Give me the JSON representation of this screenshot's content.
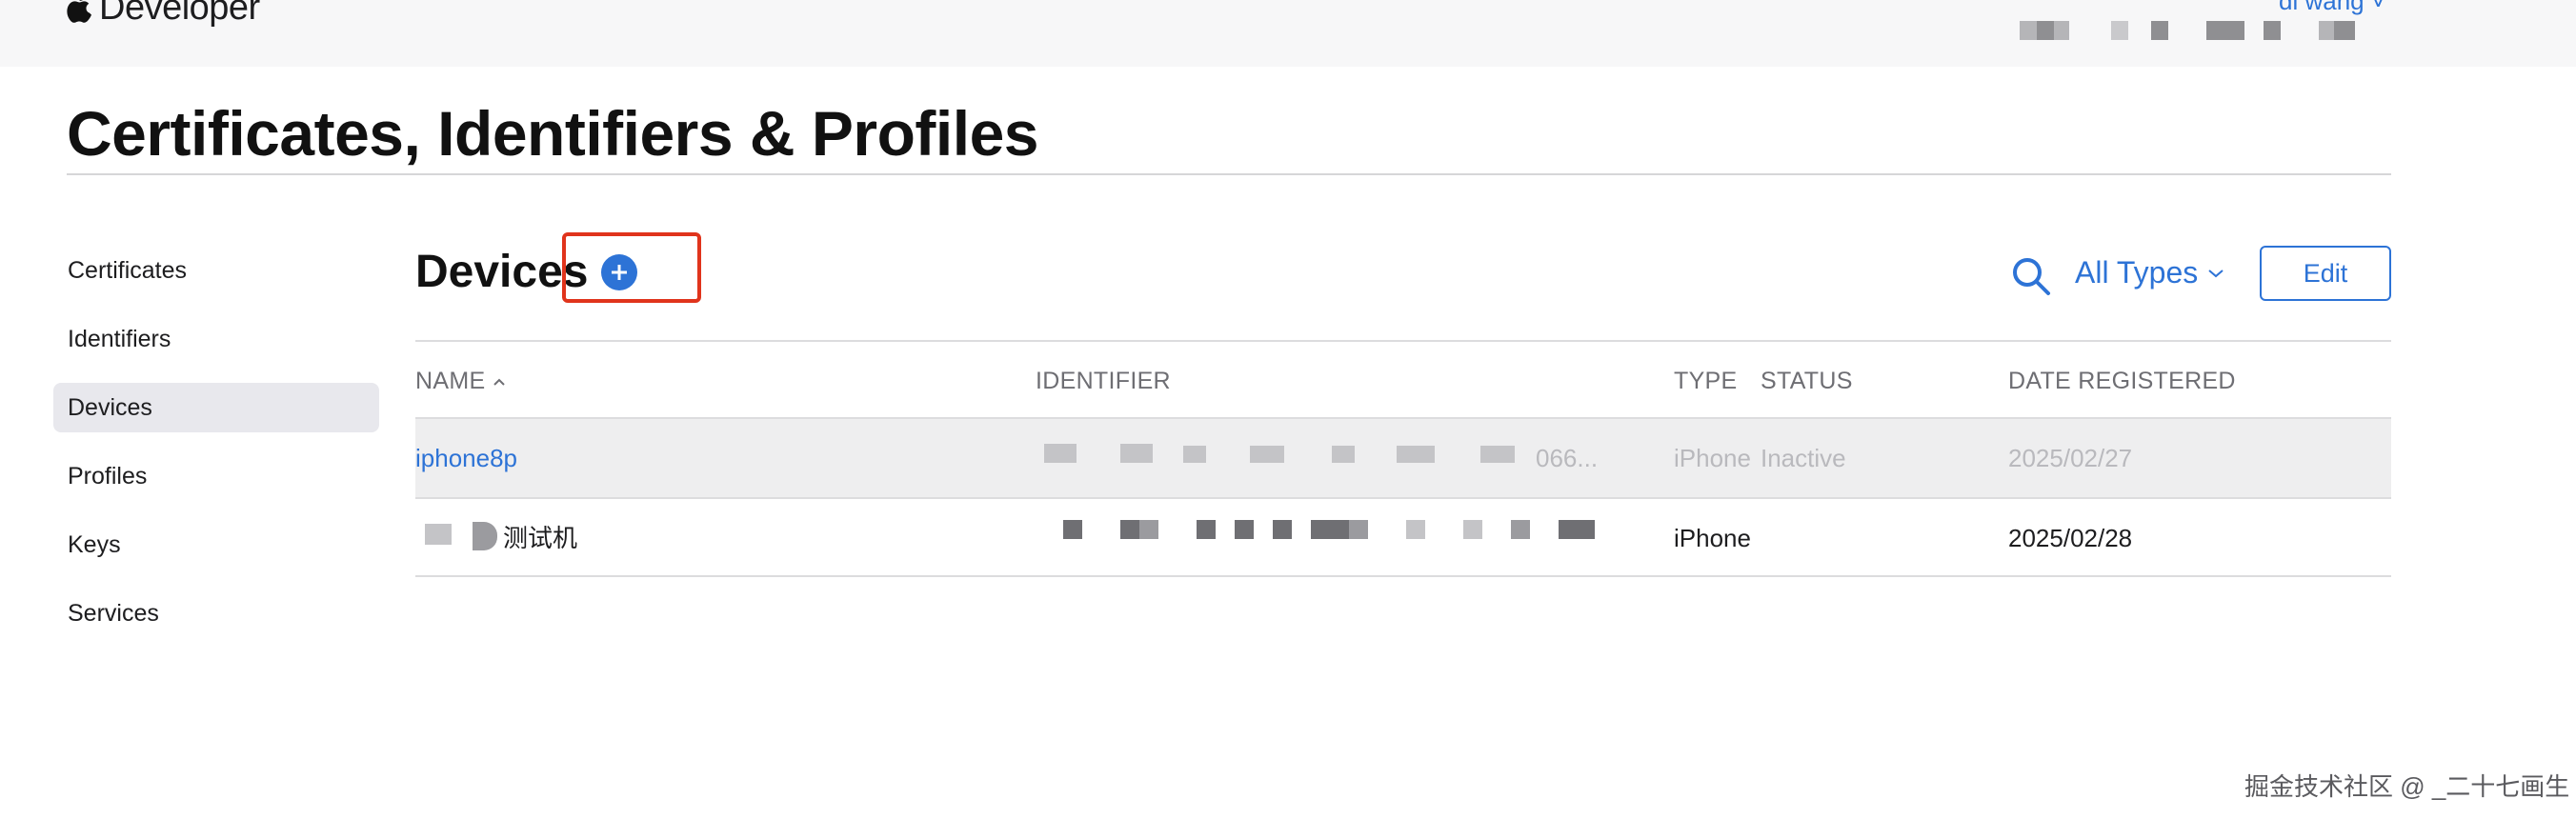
{
  "topbar": {
    "brand": "Developer",
    "user": "di wang ˅"
  },
  "page": {
    "title": "Certificates, Identifiers & Profiles"
  },
  "sidebar": {
    "items": [
      {
        "label": "Certificates",
        "active": false
      },
      {
        "label": "Identifiers",
        "active": false
      },
      {
        "label": "Devices",
        "active": true
      },
      {
        "label": "Profiles",
        "active": false
      },
      {
        "label": "Keys",
        "active": false
      },
      {
        "label": "Services",
        "active": false
      }
    ]
  },
  "devices": {
    "title": "Devices",
    "filter_label": "All Types",
    "edit_label": "Edit"
  },
  "table": {
    "columns": {
      "name": "NAME",
      "identifier": "IDENTIFIER",
      "type": "TYPE",
      "status": "STATUS",
      "date": "DATE REGISTERED"
    },
    "rows": [
      {
        "name": "iphone8p",
        "identifier_tail": "066...",
        "type": "iPhone",
        "status": "Inactive",
        "date": "2025/02/27",
        "inactive": true
      },
      {
        "name": "测试机",
        "identifier_tail": "",
        "type": "iPhone",
        "status": "",
        "date": "2025/02/28",
        "inactive": false
      }
    ]
  },
  "watermark": "掘金技术社区 @ _二十七画生",
  "colors": {
    "accent": "#2d73d6",
    "highlight": "#e0341c",
    "inactive_row": "#eeeeef"
  },
  "icons": [
    "apple-icon",
    "plus-icon",
    "search-icon",
    "chevron-down-icon",
    "sort-ascending-icon"
  ]
}
